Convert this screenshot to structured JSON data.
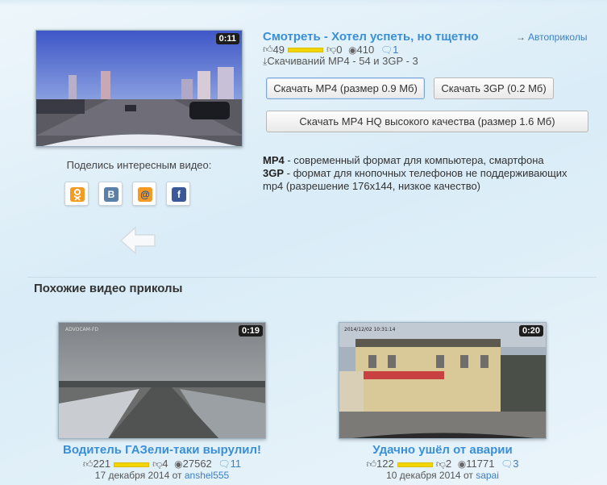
{
  "main_video": {
    "duration": "0:11",
    "title": "Смотреть - Хотел успеть, но тщетно",
    "category_arrow": "→",
    "category": "Автоприколы",
    "likes": "49",
    "dislikes": "0",
    "views": "410",
    "comments": "1",
    "rating_fraction": 1.0,
    "downloads": "Скачиваний MP4 - 54 и 3GP - 3"
  },
  "share": {
    "label": "Поделись интересным видео:",
    "buttons": [
      {
        "name": "odnoklassniki",
        "glyph": "ok",
        "color": "#f59a22"
      },
      {
        "name": "vkontakte",
        "glyph": "в",
        "color": "#5b7fa6"
      },
      {
        "name": "mailru",
        "glyph": "@",
        "color": "#f59a22"
      },
      {
        "name": "facebook",
        "glyph": "f",
        "color": "#3b5998"
      }
    ]
  },
  "buttons": {
    "mp4": "Скачать MP4 (размер 0.9 Мб)",
    "gp3": "Скачать 3GP (0.2 Мб)",
    "mp4hq": "Скачать MP4 HQ высокого качества (размер 1.6 Мб)"
  },
  "description": {
    "mp4_label": "MP4",
    "mp4_text": " - современный формат для компьютера, смартфона",
    "gp3_label": "3GP",
    "gp3_text": " - формат для кнопочных телефонов не поддерживающих mp4 (разрешение 176x144, низкое качество)"
  },
  "related": {
    "title": "Похожие видео приколы",
    "items": [
      {
        "duration": "0:19",
        "title": "Водитель ГАЗели-таки вырулил!",
        "likes": "221",
        "dislikes": "4",
        "views": "27562",
        "comments": "11",
        "date": "17 декабря 2014",
        "by": "от",
        "author": "anshel555"
      },
      {
        "duration": "0:20",
        "title": "Удачно ушёл от аварии",
        "likes": "122",
        "dislikes": "2",
        "views": "11771",
        "comments": "3",
        "date": "10 декабря 2014",
        "by": "от",
        "author": "sapai"
      }
    ]
  },
  "colors": {
    "link": "#3a8fd9",
    "rating_bar": "#f2d400"
  }
}
